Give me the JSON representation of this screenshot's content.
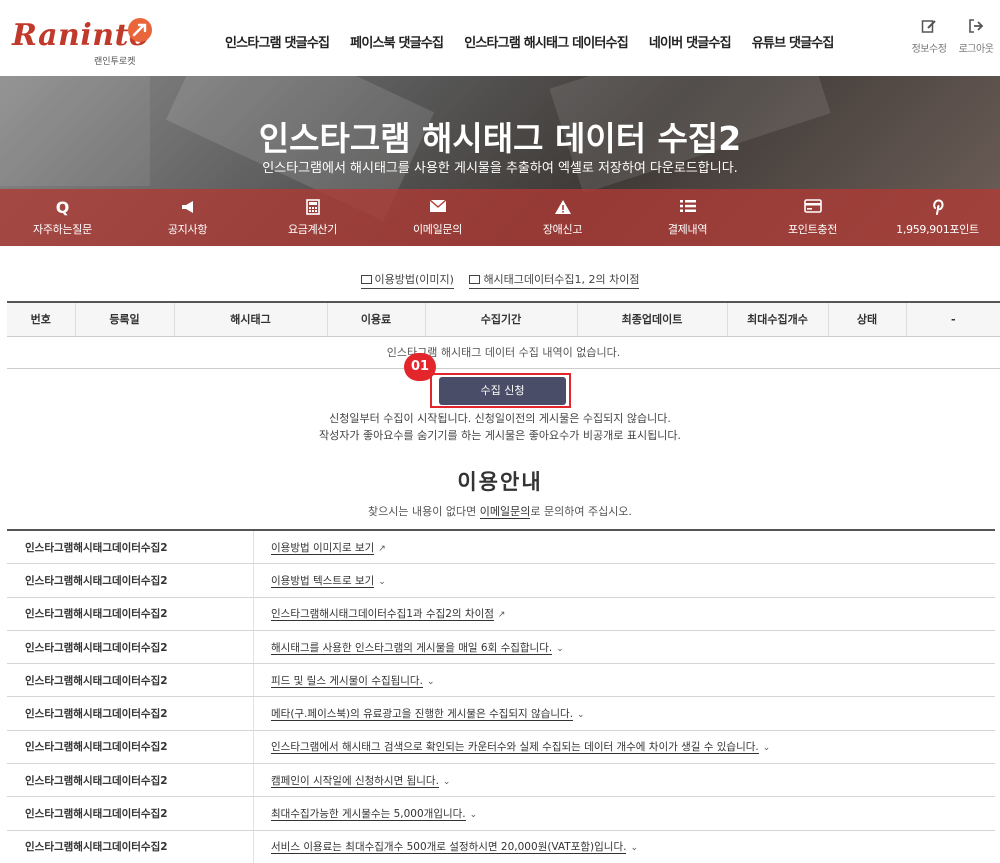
{
  "header": {
    "logo_text": "Raninto",
    "logo_subtext": "랜인투로켓",
    "nav": [
      "인스타그램 댓글수집",
      "페이스북 댓글수집",
      "인스타그램 해시태그 데이터수집",
      "네이버 댓글수집",
      "유튜브 댓글수집"
    ],
    "edit_profile": "정보수정",
    "logout": "로그아웃"
  },
  "banner": {
    "title": "인스타그램 해시태그 데이터 수집2",
    "subtitle": "인스타그램에서 해시태그를 사용한 게시물을 추출하여 엑셀로 저장하여 다운로드합니다."
  },
  "menu": [
    {
      "label": "자주하는질문",
      "icon": "q-icon"
    },
    {
      "label": "공지사항",
      "icon": "megaphone-icon"
    },
    {
      "label": "요금계산기",
      "icon": "calculator-icon"
    },
    {
      "label": "이메일문의",
      "icon": "envelope-icon"
    },
    {
      "label": "장애신고",
      "icon": "warning-icon"
    },
    {
      "label": "결제내역",
      "icon": "list-icon"
    },
    {
      "label": "포인트충전",
      "icon": "credit-card-icon"
    },
    {
      "label": "1,959,901포인트",
      "icon": "pinterest-icon"
    }
  ],
  "links": {
    "usage_image": "이용방법(이미지)",
    "difference": "해시태그데이터수집1, 2의 차이점"
  },
  "table": {
    "headers": [
      "번호",
      "등록일",
      "해시태그",
      "이용료",
      "수집기간",
      "최종업데이트",
      "최대수집개수",
      "상태",
      "-"
    ],
    "empty_message": "인스타그램 해시태그 데이터 수집 내역이 없습니다."
  },
  "apply": {
    "badge": "01",
    "button": "수집 신청",
    "note1": "신청일부터 수집이 시작됩니다. 신청일이전의 게시물은 수집되지 않습니다.",
    "note2": "작성자가 좋아요수를 숨기기를 하는 게시물은 좋아요수가 비공개로 표시됩니다."
  },
  "guide": {
    "title": "이용안내",
    "sub_before": "찾으시는 내용이 없다면 ",
    "sub_link": "이메일문의",
    "sub_after": "로 문의하여 주십시오.",
    "rows": [
      {
        "category": "인스타그램해시태그데이터수집2",
        "text": "이용방법 이미지로 보기",
        "marker": "↗"
      },
      {
        "category": "인스타그램해시태그데이터수집2",
        "text": "이용방법 텍스트로 보기",
        "marker": "⌄"
      },
      {
        "category": "인스타그램해시태그데이터수집2",
        "text": "인스타그램해시태그데이터수집1과 수집2의 차이점",
        "marker": "↗"
      },
      {
        "category": "인스타그램해시태그데이터수집2",
        "text": "해시태그를 사용한 인스타그램의 게시물을 매일 6회 수집합니다.",
        "marker": "⌄"
      },
      {
        "category": "인스타그램해시태그데이터수집2",
        "text": "피드 및 릴스 게시물이 수집됩니다.",
        "marker": "⌄"
      },
      {
        "category": "인스타그램해시태그데이터수집2",
        "text": "메타(구.페이스북)의 유료광고을 진행한 게시물은 수집되지 않습니다.",
        "marker": "⌄"
      },
      {
        "category": "인스타그램해시태그데이터수집2",
        "text": "인스타그램에서 해시태그 검색으로 확인되는 카운터수와 실제 수집되는 데이터 개수에 차이가 생길 수 있습니다.",
        "marker": "⌄"
      },
      {
        "category": "인스타그램해시태그데이터수집2",
        "text": "캠페인이 시작일에 신청하시면 됩니다.",
        "marker": "⌄"
      },
      {
        "category": "인스타그램해시태그데이터수집2",
        "text": "최대수집가능한 게시물수는 5,000개입니다.",
        "marker": "⌄"
      },
      {
        "category": "인스타그램해시태그데이터수집2",
        "text": "서비스 이용료는 최대수집개수 500개로 설정하시면 20,000원(VAT포함)입니다.",
        "marker": "⌄"
      }
    ]
  }
}
